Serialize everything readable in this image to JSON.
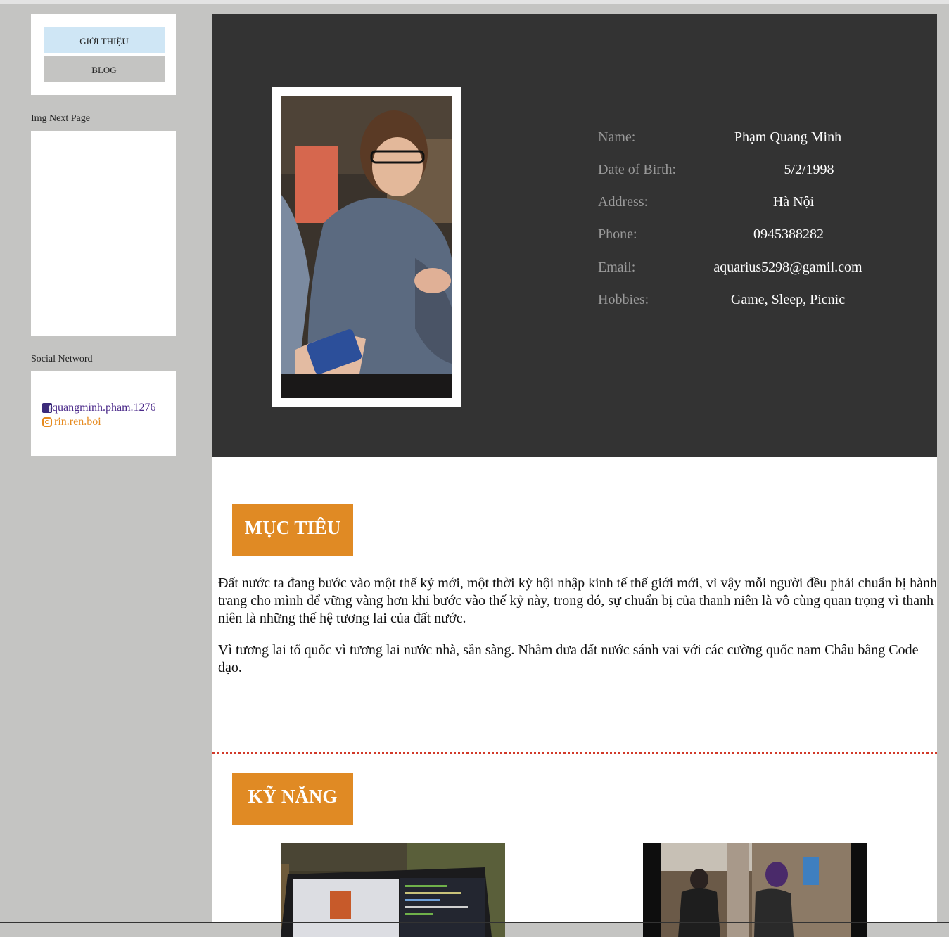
{
  "sidebar": {
    "nav": {
      "intro_label": "GIỚI THIỆU",
      "blog_label": "BLOG"
    },
    "img_section_label": "Img Next Page",
    "social_section_label": "Social Netword",
    "social": {
      "facebook": {
        "icon": "facebook-icon",
        "handle": "quangminh.pham.1276"
      },
      "instagram": {
        "icon": "instagram-icon",
        "handle": "rin.ren.boi"
      }
    }
  },
  "profile": {
    "fields": [
      {
        "label": "Name:",
        "value": "Phạm Quang Minh"
      },
      {
        "label": "Date of Birth:",
        "value": "5/2/1998"
      },
      {
        "label": "Address:",
        "value": "Hà Nội"
      },
      {
        "label": "Phone:",
        "value": "0945388282"
      },
      {
        "label": "Email:",
        "value": "aquarius5298@gamil.com"
      },
      {
        "label": "Hobbies:",
        "value": "Game, Sleep, Picnic"
      }
    ]
  },
  "objective": {
    "title": "MỤC TIÊU",
    "paragraphs": [
      "Đất nước ta đang bước vào một thế kỷ mới, một thời kỳ hội nhập kinh tế thế giới mới, vì vậy mỗi người đều phải chuẩn bị hành trang cho mình để vững vàng hơn khi bước vào thế kỷ này, trong đó, sự chuẩn bị của thanh niên là vô cùng quan trọng vì thanh niên là những thế hệ tương lai của đất nước.",
      "Vì tương lai tổ quốc vì tương lai nước nhà, sẵn sàng. Nhằm đưa đất nước sánh vai với các cường quốc nam Châu bằng Code dạo."
    ]
  },
  "skills": {
    "title": "KỸ NĂNG"
  },
  "colors": {
    "accent": "#e08a24",
    "hero_bg": "#333333",
    "divider": "#d23a2a",
    "nav_active": "#cfe6f5"
  }
}
